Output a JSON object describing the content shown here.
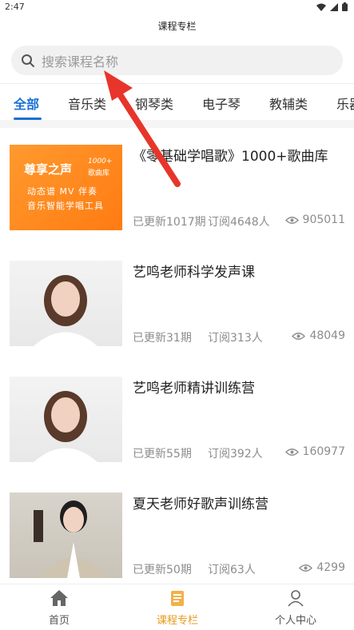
{
  "status_bar": {
    "time": "2:47",
    "icons": [
      "wifi-icon",
      "signal-icon",
      "battery-icon"
    ]
  },
  "header": {
    "title": "课程专栏"
  },
  "search": {
    "placeholder": "搜索课程名称"
  },
  "tabs": [
    {
      "label": "全部",
      "active": true
    },
    {
      "label": "音乐类",
      "active": false
    },
    {
      "label": "钢琴类",
      "active": false
    },
    {
      "label": "电子琴",
      "active": false
    },
    {
      "label": "教辅类",
      "active": false
    },
    {
      "label": "乐器",
      "active": false
    }
  ],
  "courses": [
    {
      "title": "《零基础学唱歌》1000+歌曲库",
      "updated": "已更新1017期",
      "subscribers": "订阅4648人",
      "views": "905011",
      "thumb": {
        "brand": "尊享之声",
        "badge_line1": "1000+",
        "badge_line2": "歌曲库",
        "line1": "动态谱 MV 伴奏",
        "line2": "音乐智能学唱工具"
      }
    },
    {
      "title": "艺鸣老师科学发声课",
      "updated": "已更新31期",
      "subscribers": "订阅313人",
      "views": "48049"
    },
    {
      "title": "艺鸣老师精讲训练营",
      "updated": "已更新55期",
      "subscribers": "订阅392人",
      "views": "160977"
    },
    {
      "title": "夏天老师好歌声训练营",
      "updated": "已更新50期",
      "subscribers": "订阅63人",
      "views": "4299"
    }
  ],
  "bottom_nav": [
    {
      "label": "首页",
      "icon": "home-icon",
      "active": false
    },
    {
      "label": "课程专栏",
      "icon": "book-icon",
      "active": true
    },
    {
      "label": "个人中心",
      "icon": "person-icon",
      "active": false
    }
  ],
  "colors": {
    "accent_blue": "#1a6fd6",
    "accent_orange": "#e89a1c",
    "annotation_red": "#e8352b"
  }
}
